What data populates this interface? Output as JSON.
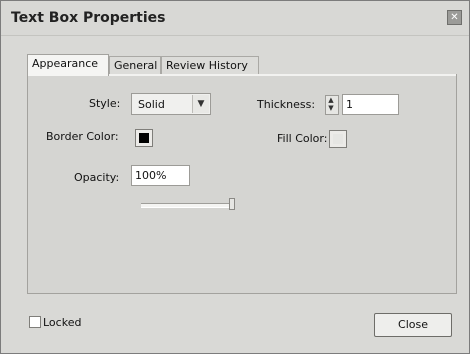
{
  "window": {
    "title": "Text Box Properties",
    "close_glyph": "✕"
  },
  "tabs": [
    {
      "label": "Appearance",
      "active": true
    },
    {
      "label": "General",
      "active": false
    },
    {
      "label": "Review History",
      "active": false
    }
  ],
  "appearance": {
    "style_label": "Style:",
    "style_value": "Solid",
    "dropdown_glyph": "▼",
    "thickness_label": "Thickness:",
    "thickness_value": "1",
    "spinner_glyph": "▲▼",
    "border_color_label": "Border Color:",
    "border_color": "#000000",
    "fill_color_label": "Fill Color:",
    "fill_color": "#e6e6e3",
    "opacity_label": "Opacity:",
    "opacity_value": "100%",
    "opacity_slider_fraction": 1.0
  },
  "footer": {
    "locked_label": "Locked",
    "locked_checked": false,
    "close_button": "Close"
  },
  "icons": {
    "close": "close-icon",
    "dropdown": "chevron-down-icon",
    "spinner": "up-down-arrows-icon"
  }
}
